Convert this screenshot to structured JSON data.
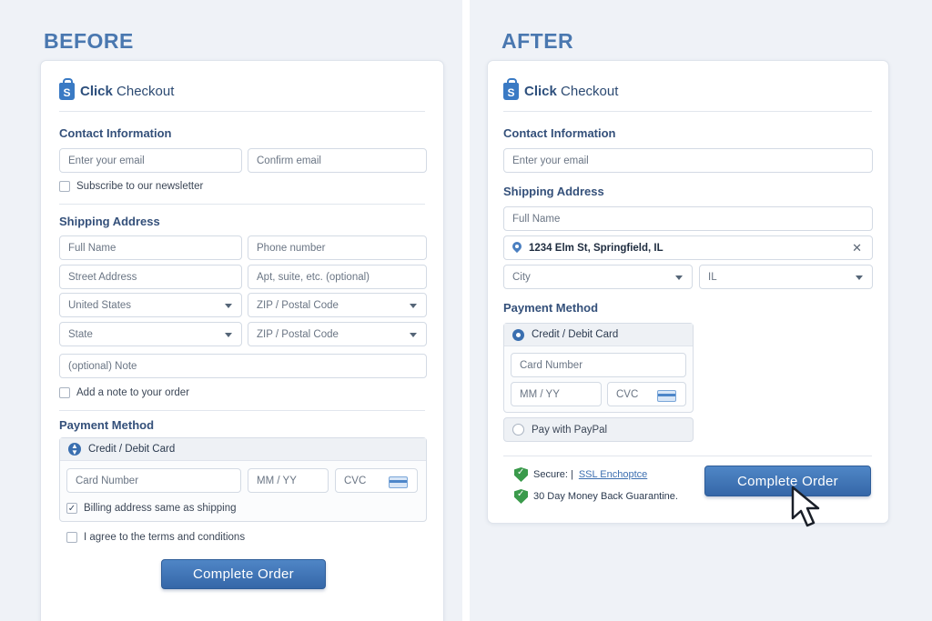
{
  "before": {
    "heading": "BEFORE",
    "brand": {
      "bold": "Click",
      "rest": " Checkout"
    },
    "contact": {
      "title": "Contact Information",
      "email_placeholder": "Enter your email",
      "confirm_placeholder": "Confirm email",
      "newsletter": "Subscribe to our newsletter"
    },
    "shipping": {
      "title": "Shipping Address",
      "full_name": "Full Name",
      "phone": "Phone number",
      "street": "Street Address",
      "apt": "Apt, suite, etc. (optional)",
      "country": "United States",
      "zip1": "ZIP / Postal Code",
      "state": "State",
      "zip2": "ZIP / Postal Code",
      "note": "(optional) Note",
      "add_note": "Add a note to your order"
    },
    "payment": {
      "title": "Payment Method",
      "method": "Credit / Debit Card",
      "card_number": "Card Number",
      "expiry": "MM / YY",
      "cvc": "CVC",
      "billing_same": "Billing address same as shipping",
      "terms": "I agree to the terms and conditions"
    },
    "submit": "Complete Order"
  },
  "after": {
    "heading": "AFTER",
    "brand": {
      "bold": "Click",
      "rest": " Checkout"
    },
    "contact": {
      "title": "Contact Information",
      "email_placeholder": "Enter your email"
    },
    "shipping": {
      "title": "Shipping Address",
      "full_name": "Full Name",
      "address_value": "1234 Elm St,  Springfield, IL",
      "city": "City",
      "state": "IL"
    },
    "payment": {
      "title": "Payment Method",
      "method_card": "Credit / Debit Card",
      "card_number": "Card Number",
      "expiry": "MM / YY",
      "cvc": "CVC",
      "method_paypal": "Pay with PayPal"
    },
    "trust": {
      "secure_label": "Secure: |",
      "secure_link": "SSL Enchoptce",
      "guarantee": "30 Day Money Back Guarantine."
    },
    "submit": "Complete Order"
  },
  "colors": {
    "accent": "#3a6fb0",
    "heading": "#4a78b0",
    "secure": "#3a9a4b"
  }
}
